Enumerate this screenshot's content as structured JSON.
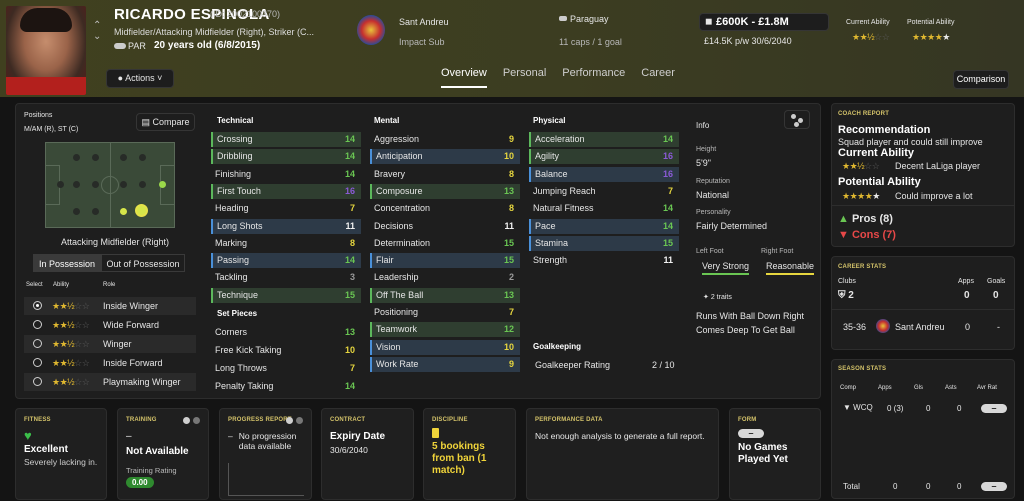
{
  "player": {
    "name": "RICARDO ESPINOLA",
    "id": "(ID: 2002100370)",
    "positions_desc": "Midfielder/Attacking Midfielder (Right), Striker (C...",
    "nation": "PAR",
    "age": "20 years old (6/8/2015)",
    "actions": "Actions"
  },
  "club": {
    "name": "Sant Andreu",
    "status": "Impact Sub"
  },
  "nation": {
    "name": "Paraguay",
    "caps": "11 caps / 1 goal"
  },
  "value": {
    "range": "£600K - £1.8M",
    "wage": "£14.5K p/w 30/6/2040"
  },
  "ability": {
    "current_label": "Current Ability",
    "potential_label": "Potential Ability",
    "current_stars": 2.5,
    "potential_stars": 4.5
  },
  "tabs": [
    "Overview",
    "Personal",
    "Performance",
    "Career"
  ],
  "comparison": "Comparison",
  "positions": {
    "label": "Positions",
    "value": "M/AM (R), ST (C)",
    "compare": "Compare",
    "role_name": "Attacking Midfielder (Right)",
    "in_possession": "In Possession",
    "out_possession": "Out of Possession",
    "col_select": "Select",
    "col_ability": "Ability",
    "col_role": "Role",
    "roles": [
      {
        "name": "Inside Winger",
        "stars": 2.5,
        "selected": true
      },
      {
        "name": "Wide Forward",
        "stars": 2.5,
        "selected": false
      },
      {
        "name": "Winger",
        "stars": 2.5,
        "selected": false
      },
      {
        "name": "Inside Forward",
        "stars": 2.5,
        "selected": false
      },
      {
        "name": "Playmaking Winger",
        "stars": 2.5,
        "selected": false
      }
    ]
  },
  "technical": {
    "title": "Technical",
    "rows": [
      {
        "n": "Crossing",
        "v": "14",
        "c": "green",
        "h": "green"
      },
      {
        "n": "Dribbling",
        "v": "14",
        "c": "green",
        "h": "green"
      },
      {
        "n": "Finishing",
        "v": "14",
        "c": "green",
        "h": ""
      },
      {
        "n": "First Touch",
        "v": "16",
        "c": "purple",
        "h": "green"
      },
      {
        "n": "Heading",
        "v": "7",
        "c": "yellow",
        "h": ""
      },
      {
        "n": "Long Shots",
        "v": "11",
        "c": "white",
        "h": "blue"
      },
      {
        "n": "Marking",
        "v": "8",
        "c": "yellow",
        "h": ""
      },
      {
        "n": "Passing",
        "v": "14",
        "c": "green",
        "h": "blue"
      },
      {
        "n": "Tackling",
        "v": "3",
        "c": "grey",
        "h": ""
      },
      {
        "n": "Technique",
        "v": "15",
        "c": "green",
        "h": "green"
      }
    ]
  },
  "setpieces": {
    "title": "Set Pieces",
    "rows": [
      {
        "n": "Corners",
        "v": "13",
        "c": "green"
      },
      {
        "n": "Free Kick Taking",
        "v": "10",
        "c": "yellow"
      },
      {
        "n": "Long Throws",
        "v": "7",
        "c": "yellow"
      },
      {
        "n": "Penalty Taking",
        "v": "14",
        "c": "green"
      }
    ]
  },
  "mental": {
    "title": "Mental",
    "rows": [
      {
        "n": "Aggression",
        "v": "9",
        "c": "yellow",
        "h": ""
      },
      {
        "n": "Anticipation",
        "v": "10",
        "c": "yellow",
        "h": "blue"
      },
      {
        "n": "Bravery",
        "v": "8",
        "c": "yellow",
        "h": ""
      },
      {
        "n": "Composure",
        "v": "13",
        "c": "green",
        "h": "green"
      },
      {
        "n": "Concentration",
        "v": "8",
        "c": "yellow",
        "h": ""
      },
      {
        "n": "Decisions",
        "v": "11",
        "c": "white",
        "h": ""
      },
      {
        "n": "Determination",
        "v": "15",
        "c": "green",
        "h": ""
      },
      {
        "n": "Flair",
        "v": "15",
        "c": "green",
        "h": "blue"
      },
      {
        "n": "Leadership",
        "v": "2",
        "c": "grey",
        "h": ""
      },
      {
        "n": "Off The Ball",
        "v": "13",
        "c": "green",
        "h": "green"
      },
      {
        "n": "Positioning",
        "v": "7",
        "c": "yellow",
        "h": ""
      },
      {
        "n": "Teamwork",
        "v": "12",
        "c": "green",
        "h": "green"
      },
      {
        "n": "Vision",
        "v": "10",
        "c": "yellow",
        "h": "blue"
      },
      {
        "n": "Work Rate",
        "v": "9",
        "c": "yellow",
        "h": "blue"
      }
    ]
  },
  "physical": {
    "title": "Physical",
    "rows": [
      {
        "n": "Acceleration",
        "v": "14",
        "c": "green",
        "h": "green"
      },
      {
        "n": "Agility",
        "v": "16",
        "c": "purple",
        "h": "green"
      },
      {
        "n": "Balance",
        "v": "16",
        "c": "purple",
        "h": "blue"
      },
      {
        "n": "Jumping Reach",
        "v": "7",
        "c": "yellow",
        "h": ""
      },
      {
        "n": "Natural Fitness",
        "v": "14",
        "c": "green",
        "h": ""
      },
      {
        "n": "Pace",
        "v": "14",
        "c": "green",
        "h": "blue"
      },
      {
        "n": "Stamina",
        "v": "15",
        "c": "green",
        "h": "blue"
      },
      {
        "n": "Strength",
        "v": "11",
        "c": "white",
        "h": ""
      }
    ]
  },
  "goalkeeping": {
    "title": "Goalkeeping",
    "label": "Goalkeeper Rating",
    "value": "2 / 10"
  },
  "info": {
    "title": "Info",
    "height_l": "Height",
    "height": "5'9\"",
    "rep_l": "Reputation",
    "rep": "National",
    "pers_l": "Personality",
    "pers": "Fairly Determined",
    "lf_l": "Left Foot",
    "lf": "Very Strong",
    "rf_l": "Right Foot",
    "rf": "Reasonable",
    "traits": "2 traits",
    "t1": "Runs With Ball Down Right",
    "t2": "Comes Deep To Get Ball"
  },
  "coach": {
    "title": "COACH REPORT",
    "rec_h": "Recommendation",
    "rec": "Squad player and could still improve",
    "ca_h": "Current Ability",
    "ca": "Decent LaLiga player",
    "ca_stars": 2.5,
    "pa_h": "Potential Ability",
    "pa": "Could improve a lot",
    "pa_stars": 4.5,
    "pros": "Pros (8)",
    "cons": "Cons (7)"
  },
  "career": {
    "title": "CAREER STATS",
    "clubs_l": "Clubs",
    "apps_l": "Apps",
    "goals_l": "Goals",
    "clubs": "2",
    "apps": "0",
    "goals": "0",
    "season": "35-36",
    "club": "Sant Andreu",
    "r_apps": "0",
    "r_goals": "-"
  },
  "season": {
    "title": "SEASON STATS",
    "comp": "Comp",
    "apps": "Apps",
    "gls": "Gls",
    "asts": "Asts",
    "avr": "Avr Rat",
    "r_comp": "WCQ",
    "r_apps": "0 (3)",
    "r_gls": "0",
    "r_asts": "0",
    "total": "Total",
    "t_apps": "0",
    "t_gls": "0",
    "t_asts": "0"
  },
  "cards": {
    "fitness": {
      "title": "FITNESS",
      "status": "Excellent",
      "sub": "Severely lacking in..."
    },
    "training": {
      "title": "TRAINING",
      "dash": "–",
      "status": "Not Available",
      "rating_l": "Training Rating",
      "rating": "0.00"
    },
    "progress": {
      "title": "PROGRESS REPORT",
      "text": "No progression data available"
    },
    "contract": {
      "title": "CONTRACT",
      "label": "Expiry Date",
      "date": "30/6/2040"
    },
    "discipline": {
      "title": "DISCIPLINE",
      "text": "5 bookings from ban (1 match)"
    },
    "performance": {
      "title": "PERFORMANCE DATA",
      "text": "Not enough analysis to generate a full report."
    },
    "form": {
      "title": "FORM",
      "text": "No Games Played Yet"
    }
  }
}
